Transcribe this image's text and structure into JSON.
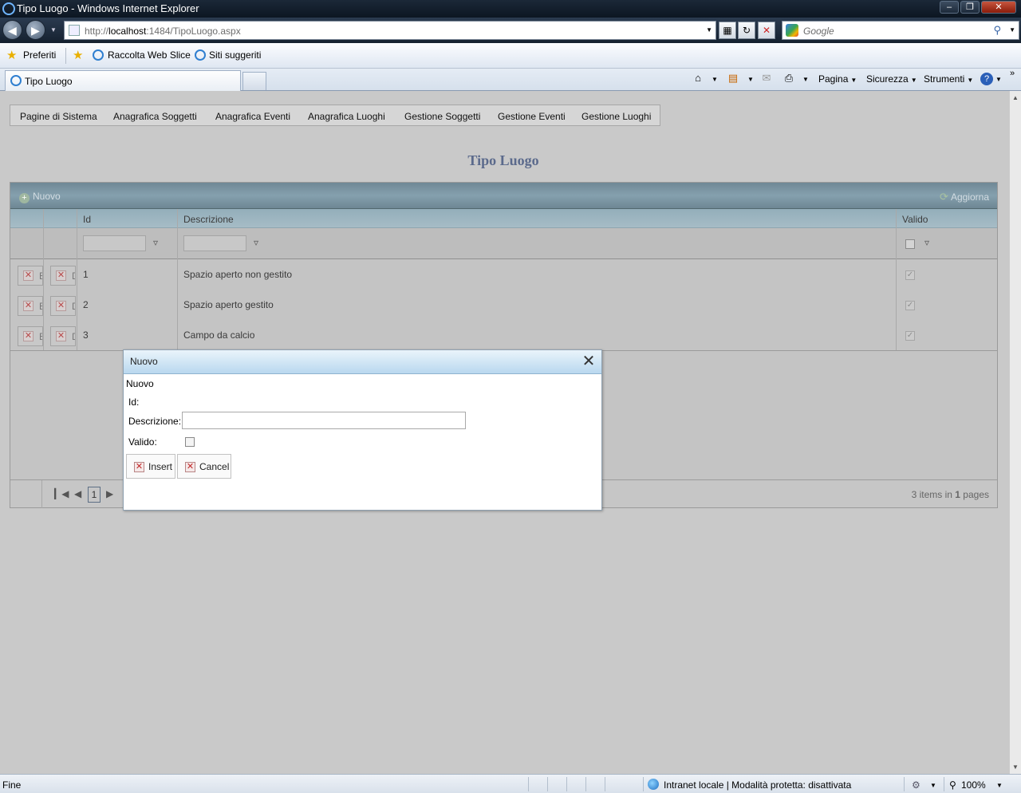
{
  "window": {
    "title": "Tipo Luogo - Windows Internet Explorer",
    "address_host_prefix": "http://",
    "address_host": "localhost",
    "address_rest": ":1484/TipoLuogo.aspx",
    "search_placeholder": "Google"
  },
  "favorites": {
    "favorites_label": "Preferiti",
    "items": [
      "Raccolta Web Slice",
      "Siti suggeriti"
    ]
  },
  "tabs": [
    {
      "label": "Tipo Luogo"
    }
  ],
  "commandbar": {
    "page": "Pagina",
    "safety": "Sicurezza",
    "tools": "Strumenti"
  },
  "menu": {
    "items": [
      "Pagine di Sistema",
      "Anagrafica Soggetti",
      "Anagrafica Eventi",
      "Anagrafica Luoghi",
      "Gestione Soggetti",
      "Gestione Eventi",
      "Gestione Luoghi"
    ]
  },
  "page_title": "Tipo Luogo",
  "grid": {
    "add_label": "Nuovo",
    "refresh_label": "Aggiorna",
    "columns": [
      "Id",
      "Descrizione",
      "Valido"
    ],
    "rows": [
      {
        "id": "1",
        "descrizione": "Spazio aperto non gestito",
        "valido": true,
        "btn1": "E",
        "btn2": "D"
      },
      {
        "id": "2",
        "descrizione": "Spazio aperto gestito",
        "valido": true,
        "btn1": "E",
        "btn2": "D"
      },
      {
        "id": "3",
        "descrizione": "Campo da calcio",
        "valido": true,
        "btn1": "E",
        "btn2": "D"
      }
    ],
    "current_page": "1",
    "pager_items_text": "3 items in ",
    "pager_pages_count": "1",
    "pager_pages_text": " pages"
  },
  "dialog": {
    "title": "Nuovo",
    "heading": "Nuovo",
    "id_label": "Id:",
    "descrizione_label": "Descrizione:",
    "descrizione_value": "",
    "valido_label": "Valido:",
    "insert_label": "Insert",
    "cancel_label": "Cancel"
  },
  "status": {
    "left": "Fine",
    "zone": "Intranet locale | Modalità protetta: disattivata",
    "zoom": "100%"
  }
}
